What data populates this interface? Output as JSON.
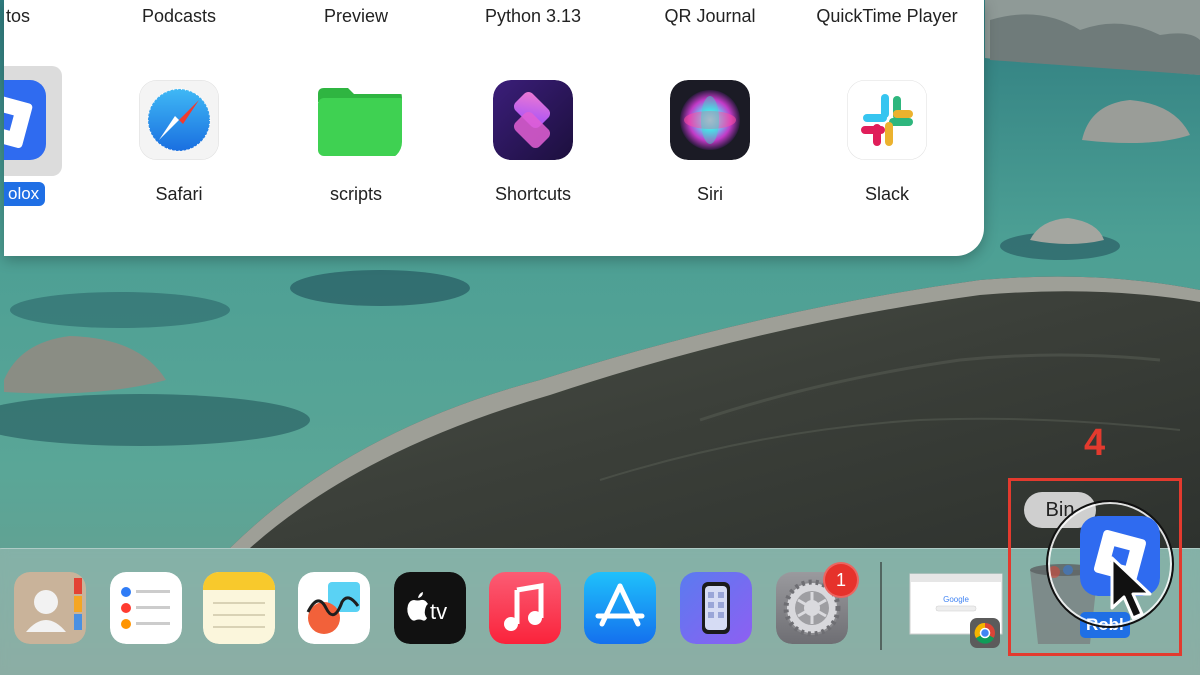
{
  "top_row_labels": [
    "tos",
    "Podcasts",
    "Preview",
    "Python 3.13",
    "QR Journal",
    "QuickTime Player"
  ],
  "selected_app": {
    "label": "olox"
  },
  "apps": [
    {
      "label": "Safari",
      "icon": "safari-icon"
    },
    {
      "label": "scripts",
      "icon": "folder-icon"
    },
    {
      "label": "Shortcuts",
      "icon": "shortcuts-icon"
    },
    {
      "label": "Siri",
      "icon": "siri-icon"
    },
    {
      "label": "Slack",
      "icon": "slack-icon"
    }
  ],
  "dock": {
    "items": [
      "contacts-icon",
      "reminders-icon",
      "notes-icon",
      "freeform-icon",
      "apple-tv-icon",
      "music-icon",
      "app-store-icon",
      "iphone-mirroring-icon",
      "system-settings-icon",
      "chrome-window-thumbnail",
      "bin-icon"
    ],
    "apple_tv_label": "tv",
    "settings_badge": "1",
    "google_logo": "Google"
  },
  "annotation": {
    "step_number": "4",
    "bin_tooltip": "Bin",
    "drag_label": "Robl",
    "accent_color": "#e33a2e"
  }
}
